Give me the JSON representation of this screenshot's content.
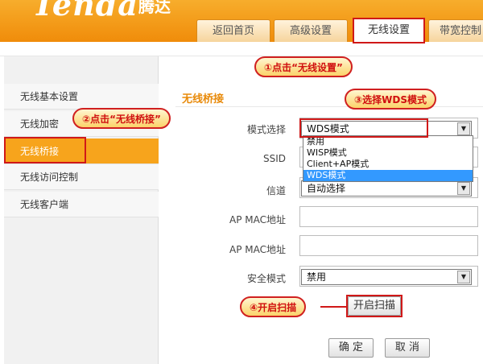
{
  "brand": {
    "logo": "Tenda",
    "name_cn": "腾达"
  },
  "tabs": [
    {
      "label": "返回首页"
    },
    {
      "label": "高级设置"
    },
    {
      "label": "无线设置"
    },
    {
      "label": "带宽控制"
    }
  ],
  "sidebar": {
    "items": [
      {
        "label": "无线基本设置"
      },
      {
        "label": "无线加密"
      },
      {
        "label": "无线桥接"
      },
      {
        "label": "无线访问控制"
      },
      {
        "label": "无线客户端"
      }
    ]
  },
  "section": {
    "title": "无线桥接"
  },
  "form": {
    "mode_label": "模式选择",
    "mode_value": "WDS模式",
    "mode_options": [
      "禁用",
      "WISP模式",
      "Client+AP模式",
      "WDS模式"
    ],
    "ssid_label": "SSID",
    "channel_label": "信道",
    "channel_value": "自动选择",
    "ap_mac_label_1": "AP MAC地址",
    "ap_mac_label_2": "AP MAC地址",
    "security_label": "安全模式",
    "security_value": "禁用",
    "scan_button": "开启扫描",
    "ok_button": "确 定",
    "cancel_button": "取 消"
  },
  "annotations": {
    "step1": "①点击“无线设置”",
    "step2": "②点击“无线桥接”",
    "step3": "③选择WDS模式",
    "step4": "④开启扫描"
  },
  "colors": {
    "header": "#f49b12",
    "active_side": "#f7a41c",
    "annotation": "#d01818",
    "title": "#e88a0a"
  }
}
